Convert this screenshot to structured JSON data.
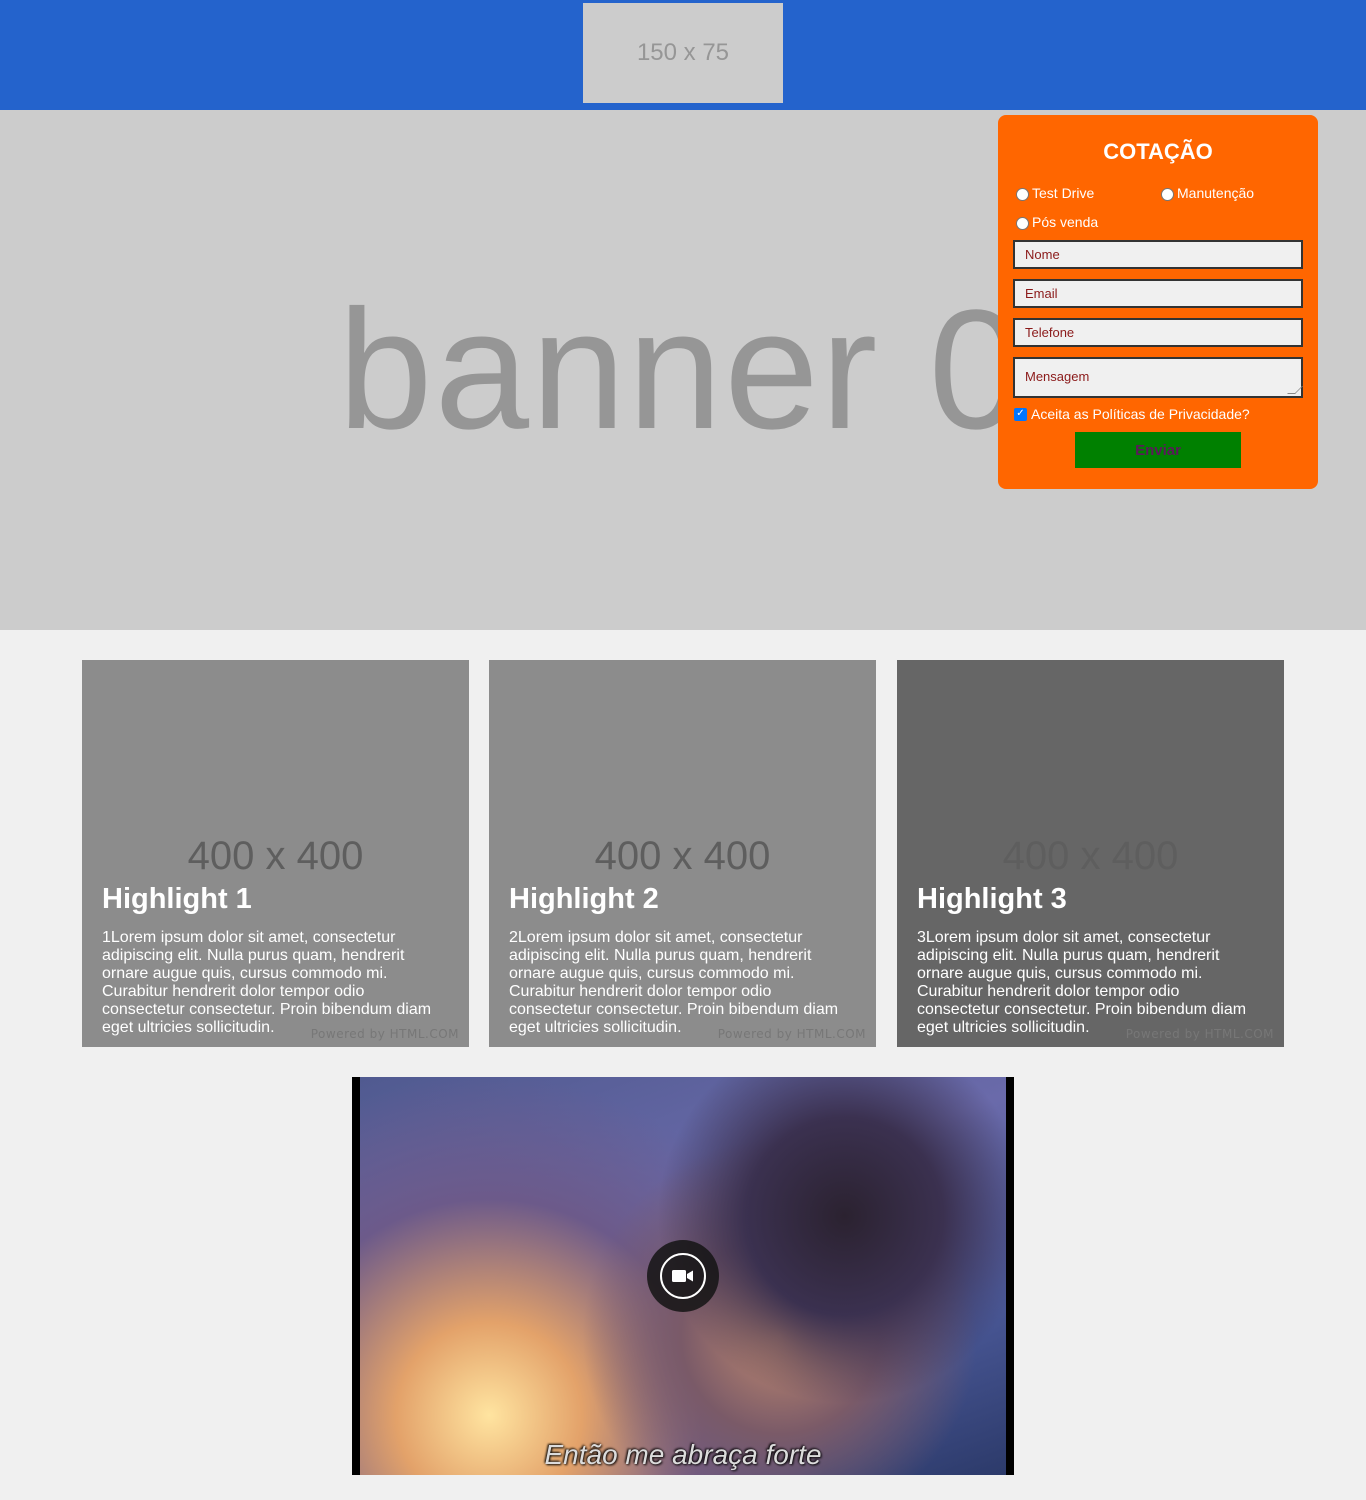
{
  "header": {
    "logo_text": "150 x 75",
    "bg_color": "#2463cc"
  },
  "banner": {
    "text": "banner 01",
    "bg_color": "#cccccc"
  },
  "form": {
    "title": "COTAÇÃO",
    "bg_color": "#ff6600",
    "radios": [
      "Test Drive",
      "Manutenção",
      "Pós venda"
    ],
    "placeholders": {
      "name": "Nome",
      "email": "Email",
      "phone": "Telefone",
      "message": "Mensagem"
    },
    "privacy_label": "Aceita as Políticas de Privacidade?",
    "privacy_checked": true,
    "submit_label": "Enviar",
    "submit_color": "#008000"
  },
  "highlights": [
    {
      "placeholder": "400 x 400",
      "title": "Highlight 1",
      "text": "1Lorem ipsum dolor sit amet, consectetur adipiscing elit. Nulla purus quam, hendrerit ornare augue quis, cursus commodo mi. Curabitur hendrerit dolor tempor odio consectetur consectetur. Proin bibendum diam eget ultricies sollicitudin.",
      "powered": "Powered by HTML.COM",
      "bg_color": "#8c8c8c"
    },
    {
      "placeholder": "400 x 400",
      "title": "Highlight 2",
      "text": "2Lorem ipsum dolor sit amet, consectetur adipiscing elit. Nulla purus quam, hendrerit ornare augue quis, cursus commodo mi. Curabitur hendrerit dolor tempor odio consectetur consectetur. Proin bibendum diam eget ultricies sollicitudin.",
      "powered": "Powered by HTML.COM",
      "bg_color": "#8c8c8c"
    },
    {
      "placeholder": "400 x 400",
      "title": "Highlight 3",
      "text": "3Lorem ipsum dolor sit amet, consectetur adipiscing elit. Nulla purus quam, hendrerit ornare augue quis, cursus commodo mi. Curabitur hendrerit dolor tempor odio consectetur consectetur. Proin bibendum diam eget ultricies sollicitudin.",
      "powered": "Powered by HTML.COM",
      "bg_color": "#666666"
    }
  ],
  "video": {
    "caption": "Então me abraça forte",
    "icon": "video-camera-icon"
  }
}
